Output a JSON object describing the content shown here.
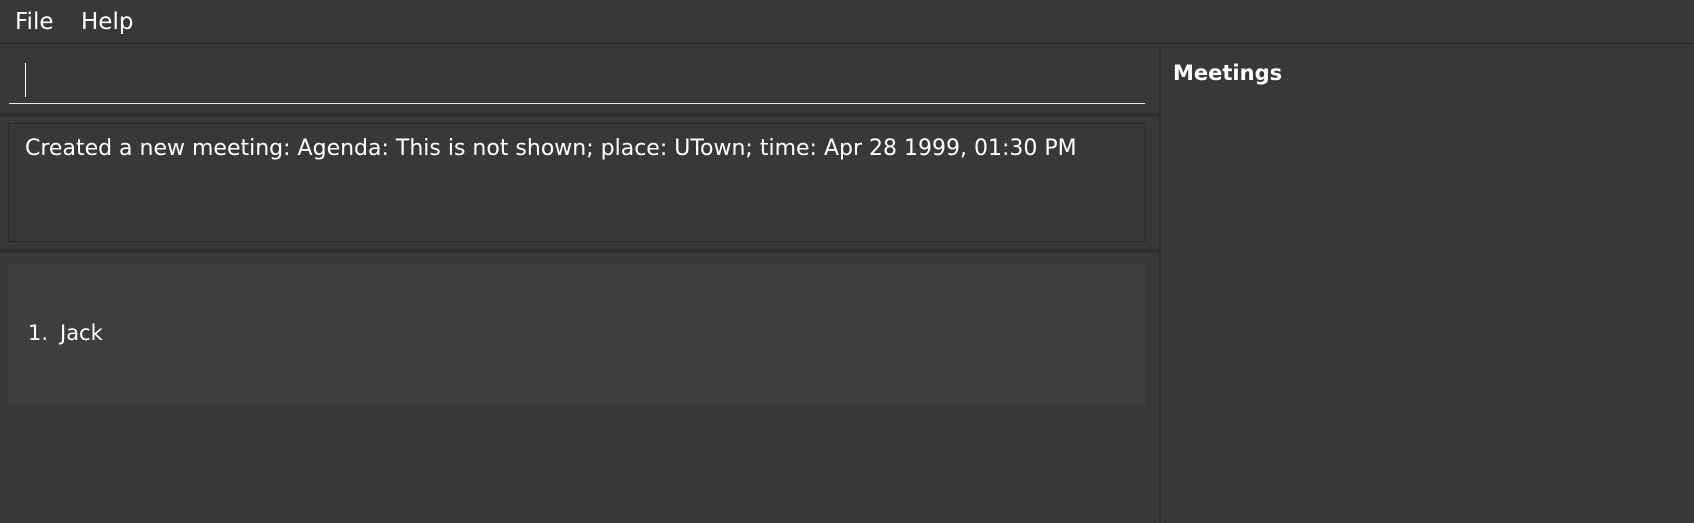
{
  "menu": {
    "items": [
      {
        "label": "File"
      },
      {
        "label": "Help"
      }
    ]
  },
  "command_box": {
    "value": "",
    "placeholder": ""
  },
  "result_display": {
    "text": "Created a new meeting: Agenda: This is not shown; place: UTown; time: Apr 28 1999, 01:30 PM"
  },
  "person_list": {
    "items": [
      {
        "index": "1.",
        "name": "Jack"
      }
    ]
  },
  "meetings_panel": {
    "title": "Meetings"
  },
  "colors": {
    "background": "#383838",
    "list_card": "#3c3e3f",
    "divider": "#2d2d2d",
    "text": "#ffffff"
  }
}
